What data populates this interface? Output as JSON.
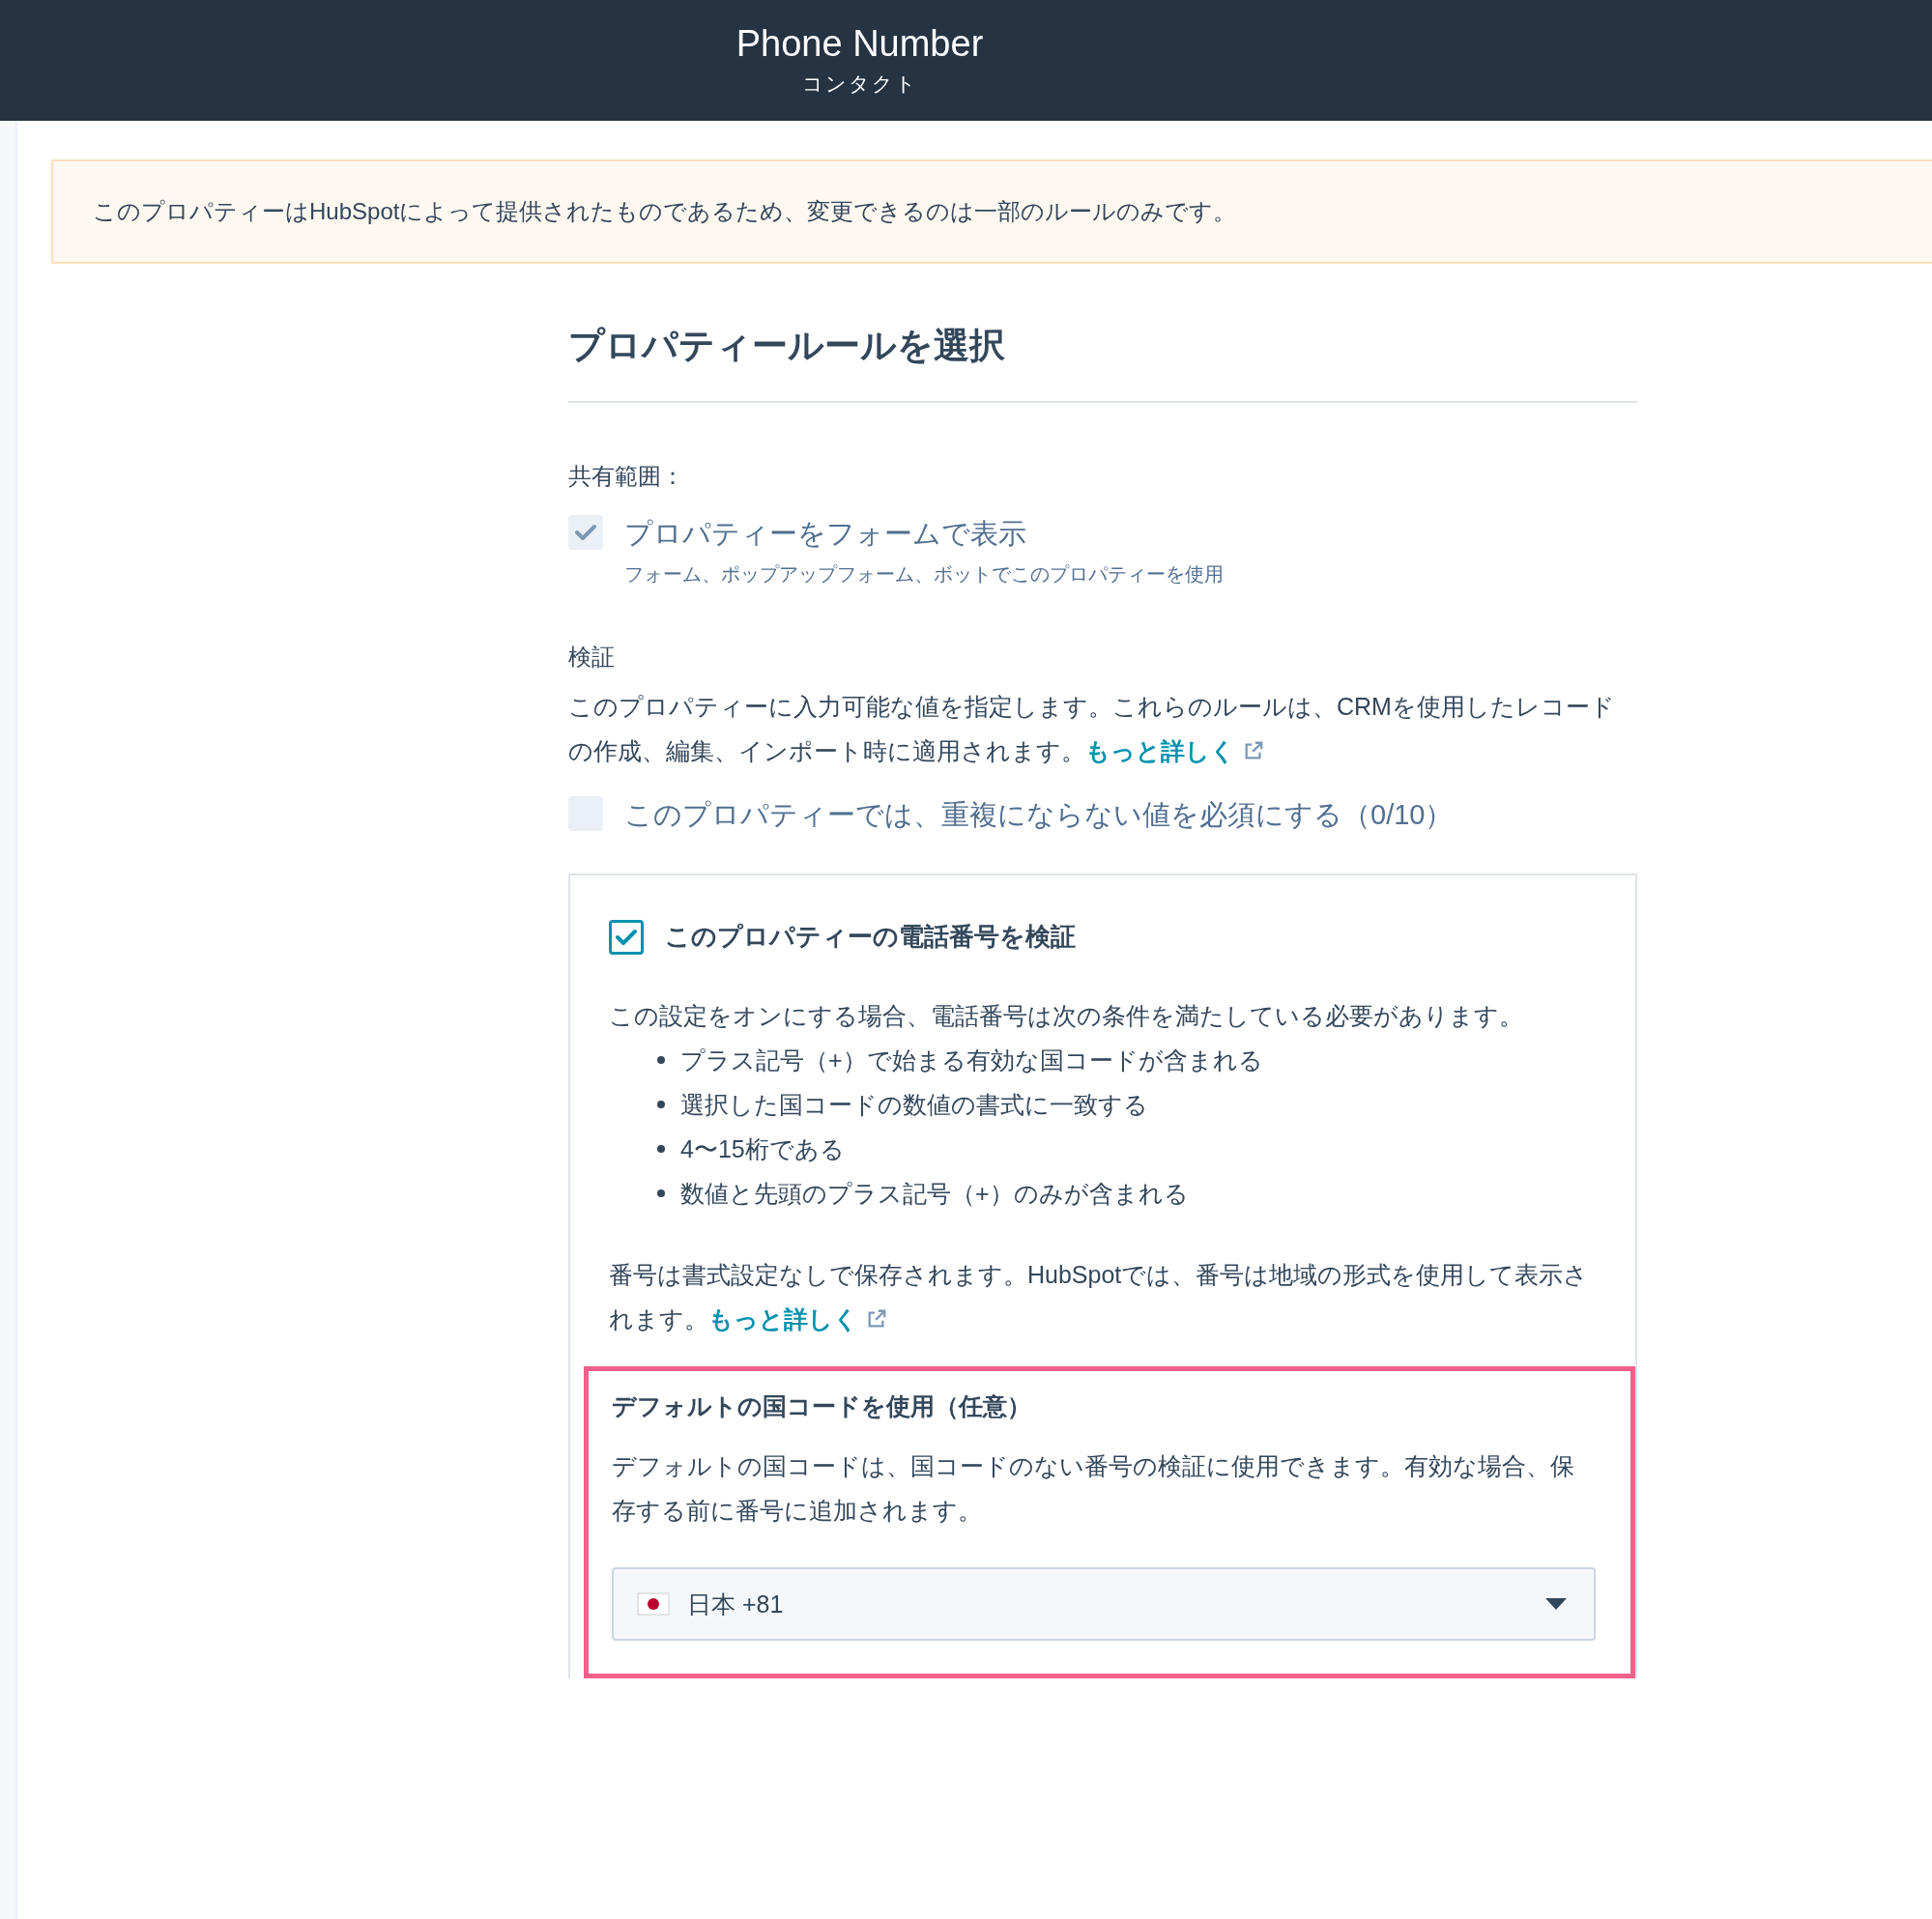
{
  "header": {
    "title": "Phone Number",
    "subtitle": "コンタクト"
  },
  "notice": "このプロパティーはHubSpotによって提供されたものであるため、変更できるのは一部のルールのみです。",
  "section_title": "プロパティールールを選択",
  "sharing": {
    "label": "共有範囲：",
    "checkbox": {
      "label": "プロパティーをフォームで表示",
      "description": "フォーム、ポップアップフォーム、ボットでこのプロパティーを使用",
      "checked": true,
      "disabled": true
    }
  },
  "validation": {
    "label": "検証",
    "description": "このプロパティーに入力可能な値を指定します。これらのルールは、CRMを使用したレコードの作成、編集、インポート時に適用されます。",
    "link": "もっと詳しく",
    "unique_checkbox": {
      "label": "このプロパティーでは、重複にならない値を必須にする（0/10）",
      "checked": false,
      "disabled": true
    }
  },
  "phone_card": {
    "checkbox": {
      "label": "このプロパティーの電話番号を検証",
      "checked": true,
      "disabled": false
    },
    "intro": "この設定をオンにする場合、電話番号は次の条件を満たしている必要があります。",
    "conditions": [
      "プラス記号（+）で始まる有効な国コードが含まれる",
      "選択した国コードの数値の書式に一致する",
      "4〜15桁である",
      "数値と先頭のプラス記号（+）のみが含まれる"
    ],
    "note": "番号は書式設定なしで保存されます。HubSpotでは、番号は地域の形式を使用して表示されます。",
    "link": "もっと詳しく",
    "default_country": {
      "highlighted": true,
      "title": "デフォルトの国コードを使用（任意）",
      "description": "デフォルトの国コードは、国コードのない番号の検証に使用できます。有効な場合、保存する前に番号に追加されます。",
      "select": {
        "value": "日本 +81"
      }
    }
  }
}
